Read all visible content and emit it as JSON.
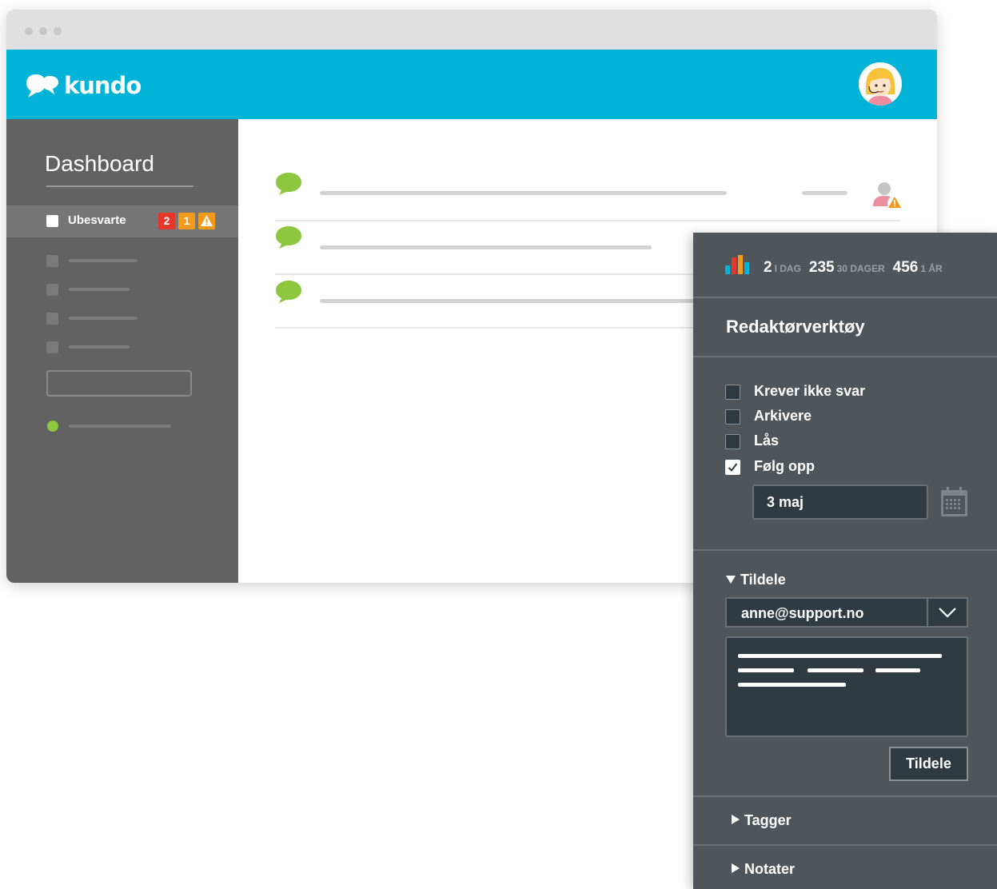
{
  "app": {
    "name": "kundo"
  },
  "colors": {
    "header": "#00b3d7",
    "sidebar": "#626262",
    "panel": "#4f5558",
    "badge_red": "#e6372b",
    "badge_orange": "#f49a1a",
    "green": "#8dc63f"
  },
  "sidebar": {
    "title": "Dashboard",
    "active_item": {
      "label": "Ubesvarte",
      "badges": [
        "2",
        "1"
      ],
      "warning_icon": "warning-icon"
    }
  },
  "stats": [
    {
      "value": "2",
      "label": "I DAG"
    },
    {
      "value": "235",
      "label": "30 DAGER"
    },
    {
      "value": "456",
      "label": "1 ÅR"
    }
  ],
  "editor": {
    "title": "Redaktørverktøy",
    "checkboxes": [
      {
        "label": "Krever ikke svar",
        "checked": false
      },
      {
        "label": "Arkivere",
        "checked": false
      },
      {
        "label": "Lås",
        "checked": false
      },
      {
        "label": "Følg opp",
        "checked": true
      }
    ],
    "followup_date": "3 maj",
    "assign": {
      "section_label": "Tildele",
      "expanded": true,
      "selected_user": "anne@support.no",
      "button_label": "Tildele"
    },
    "tags": {
      "section_label": "Tagger",
      "expanded": false
    },
    "notes": {
      "section_label": "Notater",
      "expanded": false
    }
  }
}
